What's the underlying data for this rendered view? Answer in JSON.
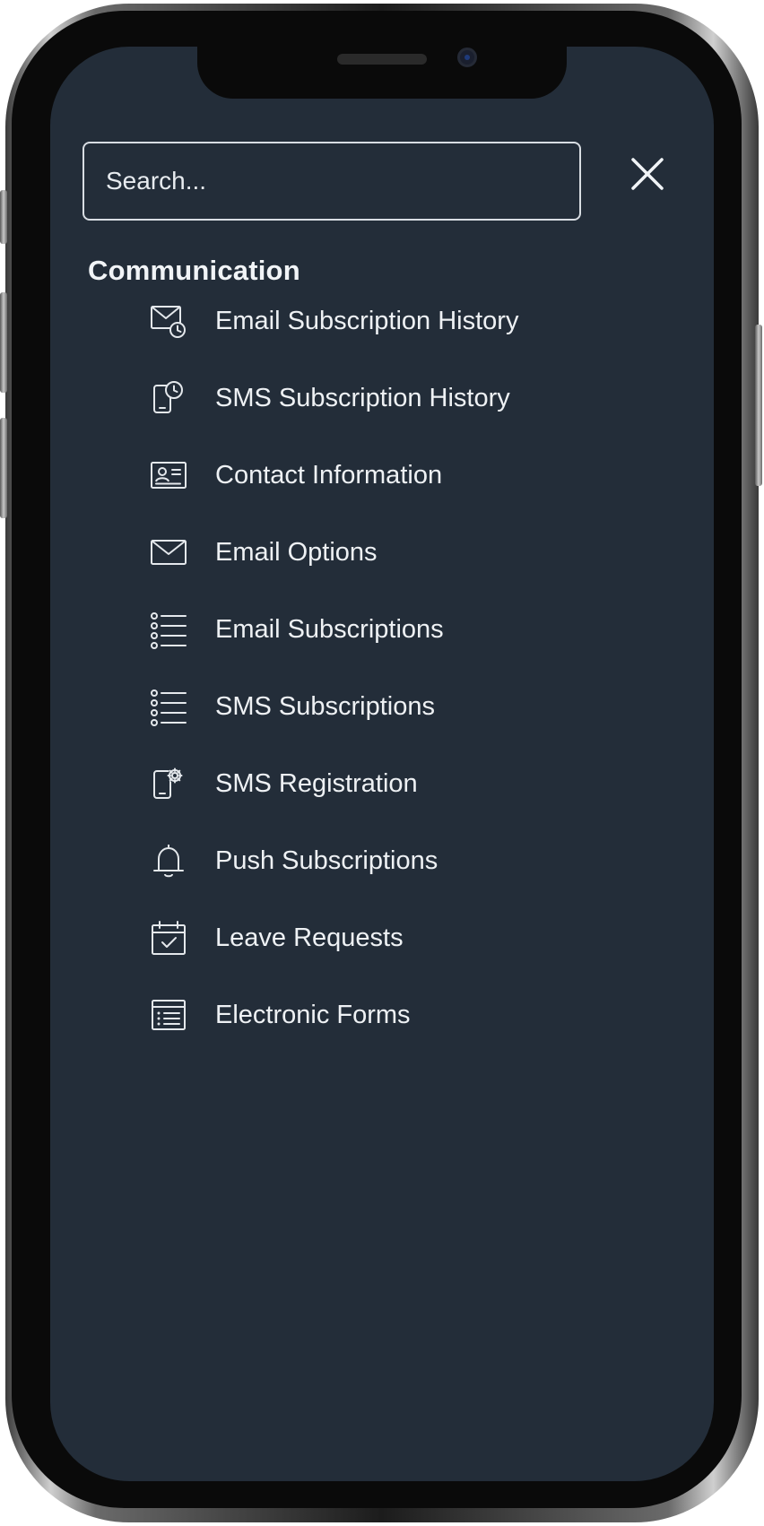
{
  "search": {
    "placeholder": "Search..."
  },
  "section": {
    "title": "Communication"
  },
  "menu": {
    "items": [
      {
        "label": "Email Subscription History",
        "icon": "email-history-icon"
      },
      {
        "label": "SMS Subscription History",
        "icon": "sms-history-icon"
      },
      {
        "label": "Contact Information",
        "icon": "contact-card-icon"
      },
      {
        "label": "Email Options",
        "icon": "envelope-icon"
      },
      {
        "label": "Email Subscriptions",
        "icon": "list-icon"
      },
      {
        "label": "SMS Subscriptions",
        "icon": "list-icon"
      },
      {
        "label": "SMS Registration",
        "icon": "phone-gear-icon"
      },
      {
        "label": "Push Subscriptions",
        "icon": "bell-icon"
      },
      {
        "label": "Leave Requests",
        "icon": "calendar-check-icon"
      },
      {
        "label": "Electronic Forms",
        "icon": "form-icon"
      }
    ]
  },
  "colors": {
    "screen_background": "#232d39",
    "text": "#eef1f4",
    "border": "#d8dde3"
  }
}
